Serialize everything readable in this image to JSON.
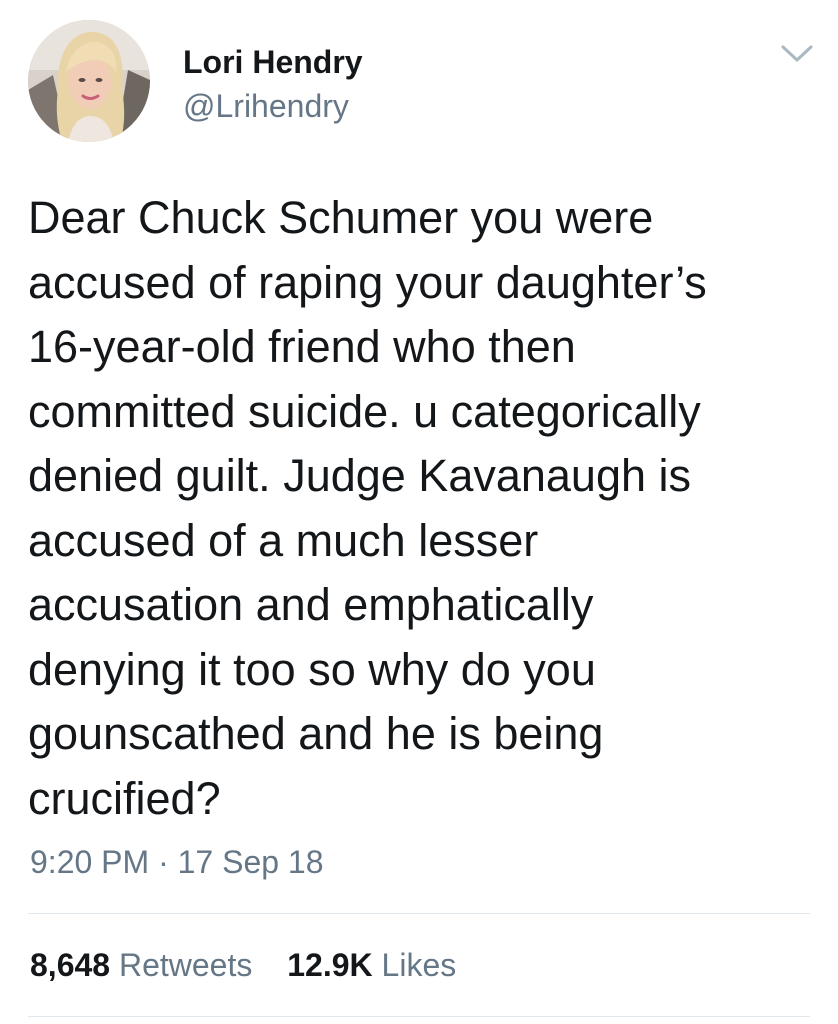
{
  "author": {
    "display_name": "Lori Hendry",
    "handle": "@Lrihendry"
  },
  "icons": {
    "menu": "chevron-down-icon",
    "avatar": "profile-photo"
  },
  "tweet": {
    "text": "Dear Chuck Schumer you were\naccused of raping your daughter’s\n16-year-old friend who then\ncommitted suicide. u categorically\ndenied guilt. Judge Kavanaugh is\naccused of a much lesser\naccusation and emphatically\ndenying it too so why do you\ngounscathed and he is being\ncrucified?",
    "time": "9:20 PM",
    "separator": "·",
    "date": "17 Sep 18"
  },
  "stats": {
    "retweets_count": "8,648",
    "retweets_label": "Retweets",
    "likes_count": "12.9K",
    "likes_label": "Likes"
  },
  "colors": {
    "text": "#14171a",
    "secondary": "#657786",
    "divider": "#e1e8ed",
    "background": "#ffffff"
  }
}
